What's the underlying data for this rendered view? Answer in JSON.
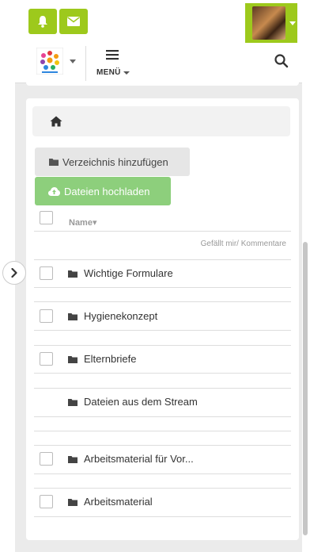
{
  "header": {
    "menu_label": "MENÜ"
  },
  "toolbar": {
    "add_directory_label": "Verzeichnis hinzufügen",
    "upload_label": "Dateien hochladen"
  },
  "table": {
    "name_header": "Name▾",
    "likes_comments_header": "Gefällt mir/ Kommentare",
    "rows": [
      {
        "label": "Wichtige Formulare",
        "checkbox": true
      },
      {
        "label": "Hygienekonzept",
        "checkbox": true
      },
      {
        "label": "Elternbriefe",
        "checkbox": true
      },
      {
        "label": "Dateien aus dem Stream",
        "checkbox": false
      },
      {
        "label": "Arbeitsmaterial für Vor...",
        "checkbox": true
      },
      {
        "label": "Arbeitsmaterial",
        "checkbox": true
      }
    ]
  },
  "colors": {
    "accent_green": "#9dc91c",
    "upload_green": "#8dcf7c"
  },
  "icons": [
    "bell-icon",
    "envelope-icon",
    "hamburger-icon",
    "search-icon",
    "home-icon",
    "folder-icon",
    "cloud-upload-icon",
    "chevron-right-icon"
  ]
}
